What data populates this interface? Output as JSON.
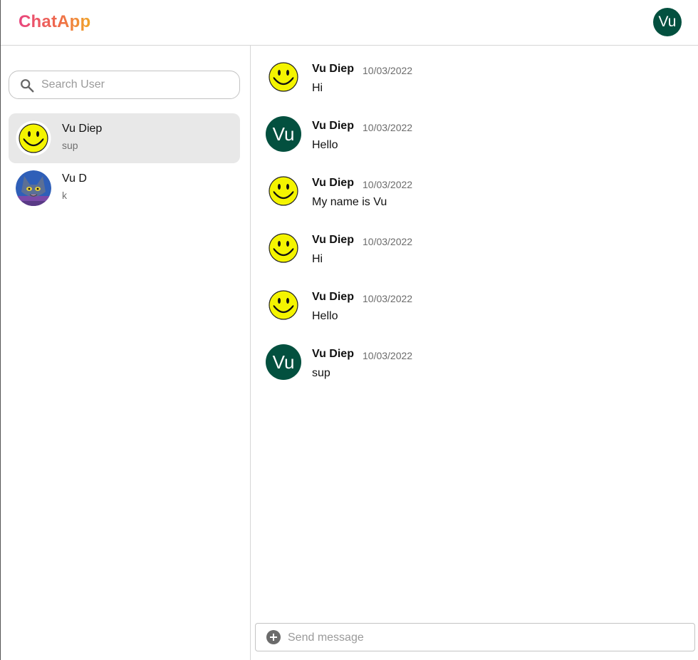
{
  "app": {
    "brand": "ChatApp",
    "current_user_initials": "Vu"
  },
  "colors": {
    "brand_gradient_start": "#e8457f",
    "brand_gradient_end": "#f0a52a",
    "avatar_green": "#03503f",
    "active_item_bg": "#e8e8e8"
  },
  "search": {
    "placeholder": "Search User",
    "value": ""
  },
  "users": [
    {
      "name": "Vu Diep",
      "last_message": "sup",
      "avatar": "smiley-avatar",
      "active": true
    },
    {
      "name": "Vu D",
      "last_message": "k",
      "avatar": "cartoon-cat-avatar",
      "active": false
    }
  ],
  "messages": [
    {
      "author": "Vu Diep",
      "time": "10/03/2022",
      "text": "Hi",
      "avatar": "smiley"
    },
    {
      "author": "Vu Diep",
      "time": "10/03/2022",
      "text": "Hello",
      "avatar": "initials",
      "initials": "Vu"
    },
    {
      "author": "Vu Diep",
      "time": "10/03/2022",
      "text": "My name is Vu",
      "avatar": "smiley"
    },
    {
      "author": "Vu Diep",
      "time": "10/03/2022",
      "text": "Hi",
      "avatar": "smiley"
    },
    {
      "author": "Vu Diep",
      "time": "10/03/2022",
      "text": "Hello",
      "avatar": "smiley"
    },
    {
      "author": "Vu Diep",
      "time": "10/03/2022",
      "text": "sup",
      "avatar": "initials",
      "initials": "Vu"
    }
  ],
  "composer": {
    "placeholder": "Send message",
    "value": "",
    "add_icon": "add-circle-icon"
  }
}
